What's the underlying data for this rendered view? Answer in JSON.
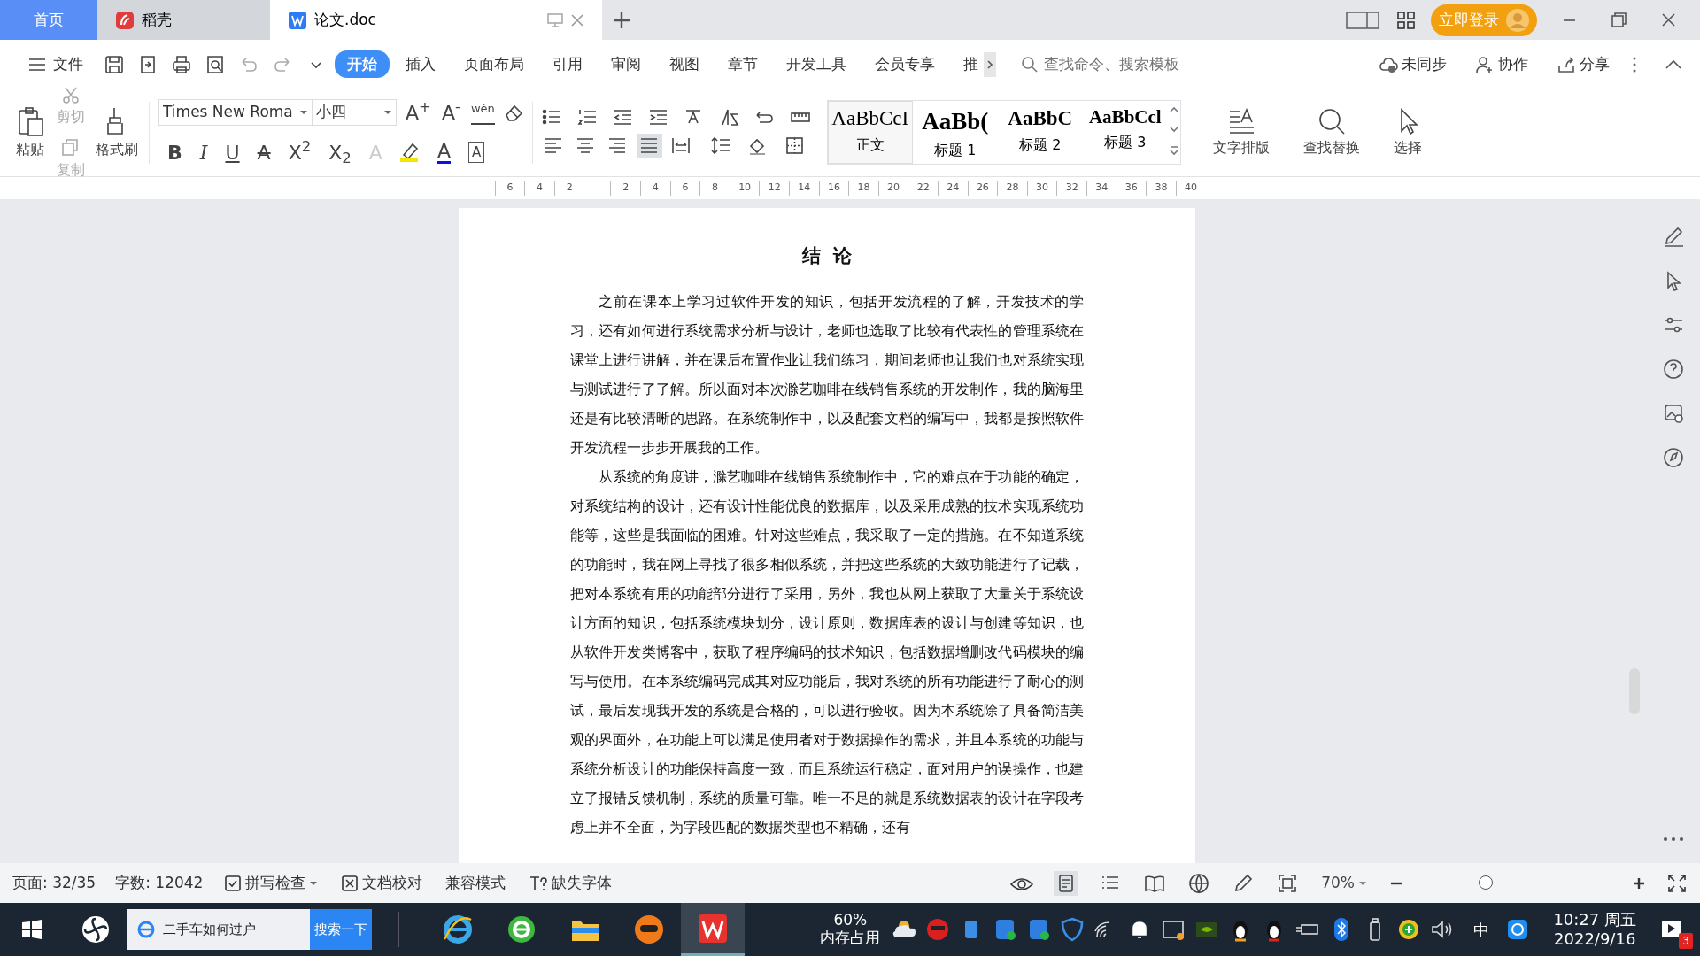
{
  "tabs": [
    {
      "label": "首页",
      "kind": "home",
      "selected": false
    },
    {
      "label": "稻壳",
      "kind": "app",
      "selected": false
    },
    {
      "label": "论文.doc",
      "kind": "document",
      "selected": true
    }
  ],
  "login_button": "立即登录",
  "menu": {
    "file": "文件",
    "tabs": [
      {
        "label": "开始",
        "selected": true
      },
      {
        "label": "插入",
        "selected": false
      },
      {
        "label": "页面布局",
        "selected": false
      },
      {
        "label": "引用",
        "selected": false
      },
      {
        "label": "审阅",
        "selected": false
      },
      {
        "label": "视图",
        "selected": false
      },
      {
        "label": "章节",
        "selected": false
      },
      {
        "label": "开发工具",
        "selected": false
      },
      {
        "label": "会员专享",
        "selected": false
      },
      {
        "label": "推",
        "selected": false
      }
    ],
    "search": {
      "placeholder": "查找命令、搜索模板"
    },
    "actions": [
      "未同步",
      "协作",
      "分享"
    ]
  },
  "ribbon": {
    "clipboard": [
      {
        "label": "粘贴",
        "kind": "large",
        "disabled": false
      },
      {
        "label": "剪切",
        "kind": "small",
        "disabled": true
      },
      {
        "label": "复制",
        "kind": "small",
        "disabled": true
      },
      {
        "label": "格式刷",
        "kind": "large",
        "disabled": false
      }
    ],
    "font_name": "Times New Roma",
    "font_size": "小四",
    "font_buttons": [
      {
        "text": "A$^{+}$",
        "kind": "grow"
      },
      {
        "text": "A$^{-}$",
        "kind": "shrink"
      },
      {
        "text": "wén",
        "kind": "phonetic"
      }
    ],
    "format_buttons": [
      {
        "text": "B",
        "kind": "bold"
      },
      {
        "text": "I",
        "kind": "italic"
      },
      {
        "text": "U",
        "kind": "underline"
      },
      {
        "text": "A",
        "kind": "strike"
      },
      {
        "text": "X$^{2}$",
        "kind": "sup"
      },
      {
        "text": "X$_{2}$",
        "kind": "sub"
      },
      {
        "text": "A",
        "kind": "effect"
      },
      {
        "text": "A",
        "kind": "color"
      },
      {
        "text": "A",
        "kind": "border"
      }
    ],
    "alignment": [
      {
        "selected": false
      },
      {
        "selected": false
      },
      {
        "selected": false
      },
      {
        "selected": true
      },
      {
        "selected": false
      }
    ],
    "styles": [
      {
        "preview": "AaBbCcI",
        "label": "正文",
        "kind": "normal",
        "selected": true
      },
      {
        "preview": "AaBb(",
        "label": "标题 1",
        "kind": "h1",
        "selected": false
      },
      {
        "preview": "AaBbC",
        "label": "标题 2",
        "kind": "h2",
        "selected": false
      },
      {
        "preview": "AaBbCcl",
        "label": "标题 3",
        "kind": "h3",
        "selected": false
      }
    ],
    "tools": [
      "文字排版",
      "查找替换",
      "选择"
    ]
  },
  "ruler": [
    "6",
    "4",
    "2",
    "2",
    "4",
    "6",
    "8",
    "10",
    "12",
    "14",
    "16",
    "18",
    "20",
    "22",
    "24",
    "26",
    "28",
    "30",
    "32",
    "34",
    "36",
    "38",
    "40"
  ],
  "document": {
    "heading": "结  论",
    "paragraphs": [
      "之前在课本上学习过软件开发的知识，包括开发流程的了解，开发技术的学习，还有如何进行系统需求分析与设计，老师也选取了比较有代表性的管理系统在课堂上进行讲解，并在课后布置作业让我们练习，期间老师也让我们也对系统实现与测试进行了了解。所以面对本次滁艺咖啡在线销售系统的开发制作，我的脑海里还是有比较清晰的思路。在系统制作中，以及配套文档的编写中，我都是按照软件开发流程一步步开展我的工作。",
      "从系统的角度讲，滁艺咖啡在线销售系统制作中，它的难点在于功能的确定，对系统结构的设计，还有设计性能优良的数据库，以及采用成熟的技术实现系统功能等，这些是我面临的困难。针对这些难点，我采取了一定的措施。在不知道系统的功能时，我在网上寻找了很多相似系统，并把这些系统的大致功能进行了记载，把对本系统有用的功能部分进行了采用，另外，我也从网上获取了大量关于系统设计方面的知识，包括系统模块划分，设计原则，数据库表的设计与创建等知识，也从软件开发类博客中，获取了程序编码的技术知识，包括数据增删改代码模块的编写与使用。在本系统编码完成其对应功能后，我对系统的所有功能进行了耐心的测试，最后发现我开发的系统是合格的，可以进行验收。因为本系统除了具备简洁美观的界面外，在功能上可以满足使用者对于数据操作的需求，并且本系统的功能与系统分析设计的功能保持高度一致，而且系统运行稳定，面对用户的误操作，也建立了报错反馈机制，系统的质量可靠。唯一不足的就是系统数据表的设计在字段考虑上并不全面，为字段匹配的数据类型也不精确，还有"
    ]
  },
  "status_bar": {
    "page": "页面: 32/35",
    "word_count": "字数: 12042",
    "items": [
      {
        "label": "拼写检查",
        "kind": "check"
      },
      {
        "label": "文档校对",
        "kind": "proof"
      },
      {
        "label": "兼容模式",
        "kind": "plain"
      },
      {
        "label": "缺失字体",
        "kind": "font"
      }
    ],
    "views": [
      {
        "selected": true
      },
      {
        "selected": false
      },
      {
        "selected": false
      },
      {
        "selected": false
      },
      {
        "selected": false
      },
      {
        "selected": false
      }
    ],
    "zoom": "70%",
    "zoom_slider": {
      "level": 0.33
    }
  },
  "taskbar": {
    "search": {
      "value": "二手车如何过户"
    },
    "search_button": "搜索一下",
    "memory": {
      "percent": "60%",
      "label": "内存占用"
    },
    "ime": "中",
    "time": "10:27 周五",
    "date": "2022/9/16",
    "notification_count": "3"
  }
}
